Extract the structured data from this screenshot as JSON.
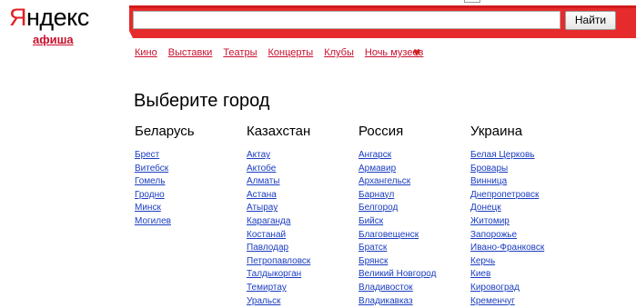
{
  "logo": {
    "first_letter": "Я",
    "rest": "ндекс"
  },
  "afisha": "афиша",
  "search": {
    "value": "",
    "button_label": "Найти"
  },
  "nav": {
    "items": [
      {
        "label": "Кино"
      },
      {
        "label": "Выставки"
      },
      {
        "label": "Театры"
      },
      {
        "label": "Концерты"
      },
      {
        "label": "Клубы"
      },
      {
        "label": "Ночь музеев"
      }
    ],
    "heart_icon": "heart-icon"
  },
  "page_title": "Выберите город",
  "colors": {
    "accent_red": "#e52b2b",
    "link_blue": "#1a3dc1",
    "nav_red": "#c8102e"
  },
  "countries": [
    {
      "name": "Беларусь",
      "cities": [
        "Брест",
        "Витебск",
        "Гомель",
        "Гродно",
        "Минск",
        "Могилев"
      ]
    },
    {
      "name": "Казахстан",
      "cities": [
        "Актау",
        "Актобе",
        "Алматы",
        "Астана",
        "Атырау",
        "Караганда",
        "Костанай",
        "Павлодар",
        "Петропавловск",
        "Талдыкорган",
        "Темиртау",
        "Уральск"
      ]
    },
    {
      "name": "Россия",
      "cities": [
        "Ангарск",
        "Армавир",
        "Архангельск",
        "Барнаул",
        "Белгород",
        "Бийск",
        "Благовещенск",
        "Братск",
        "Брянск",
        "Великий Новгород",
        "Владивосток",
        "Владикавказ"
      ]
    },
    {
      "name": "Украина",
      "cities": [
        "Белая Церковь",
        "Бровары",
        "Винница",
        "Днепропетровск",
        "Донецк",
        "Житомир",
        "Запорожье",
        "Ивано-Франковск",
        "Керчь",
        "Киев",
        "Кировоград",
        "Кременчуг"
      ]
    }
  ]
}
